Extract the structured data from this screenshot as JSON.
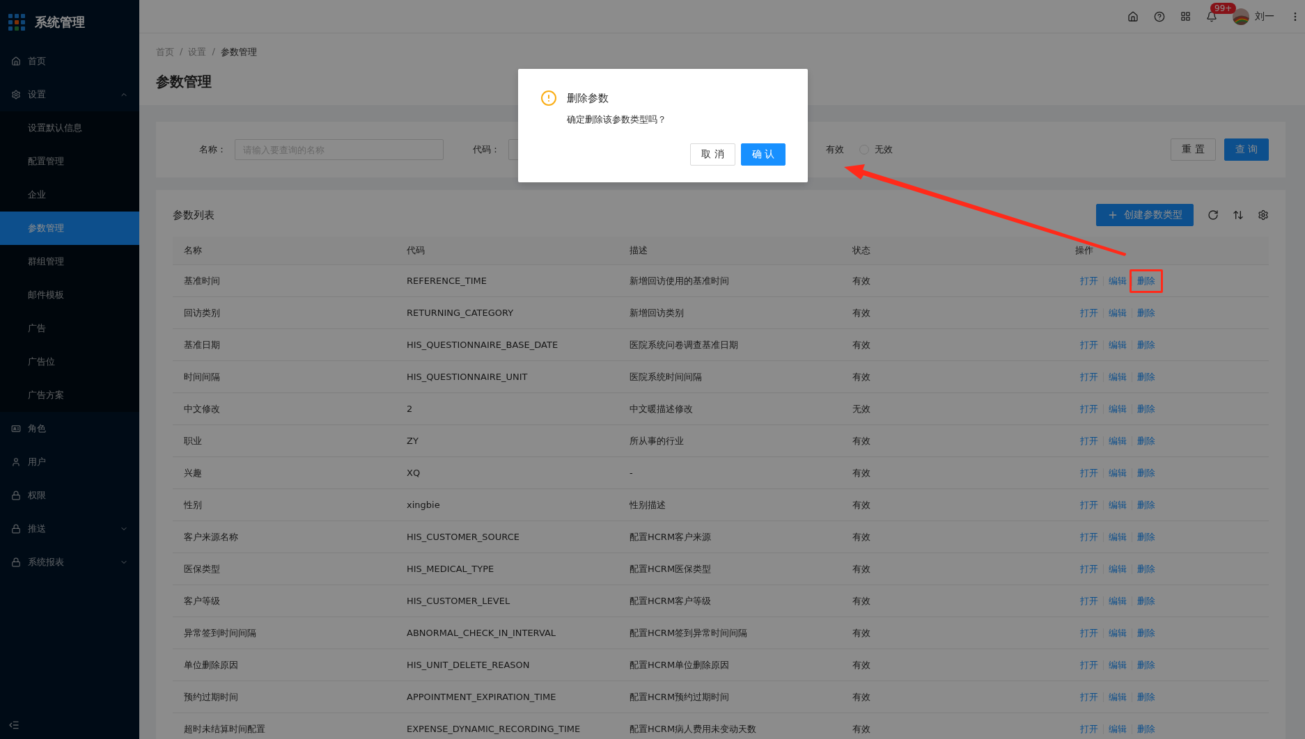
{
  "sidebar": {
    "title": "系统管理",
    "items": [
      {
        "label": "首页"
      },
      {
        "label": "设置",
        "expanded": true,
        "children": [
          {
            "label": "设置默认信息",
            "selected": false
          },
          {
            "label": "配置管理",
            "selected": false
          },
          {
            "label": "企业",
            "selected": false
          },
          {
            "label": "参数管理",
            "selected": true
          },
          {
            "label": "群组管理",
            "selected": false
          },
          {
            "label": "邮件模板",
            "selected": false
          },
          {
            "label": "广告",
            "selected": false
          },
          {
            "label": "广告位",
            "selected": false
          },
          {
            "label": "广告方案",
            "selected": false
          }
        ]
      },
      {
        "label": "角色"
      },
      {
        "label": "用户"
      },
      {
        "label": "权限"
      },
      {
        "label": "推送",
        "expanded": false
      },
      {
        "label": "系统报表",
        "expanded": false
      }
    ]
  },
  "header": {
    "notification_badge": "99+",
    "user_name": "刘一"
  },
  "breadcrumb": {
    "separator": "/",
    "items": [
      "首页",
      "设置",
      "参数管理"
    ]
  },
  "page_title": "参数管理",
  "filter": {
    "fields": [
      {
        "label": "名称：",
        "placeholder": "请输入要查询的名称"
      },
      {
        "label": "代码："
      }
    ],
    "status_options": [
      {
        "label": "有效"
      },
      {
        "label": "无效",
        "selected": false
      }
    ],
    "buttons": [
      "重 置",
      "查 询"
    ]
  },
  "table": {
    "title": "参数列表",
    "create_button": "创建参数类型",
    "columns": [
      "名称",
      "代码",
      "描述",
      "状态",
      "操作"
    ],
    "rows": [
      {
        "name": "基准时间",
        "code": "REFERENCE_TIME",
        "description": "新增回访使用的基准时间",
        "status": "有效",
        "actions": [
          "打开",
          "编辑",
          "删除"
        ],
        "marked": true
      },
      {
        "name": "回访类别",
        "code": "RETURNING_CATEGORY",
        "description": "新增回访类别",
        "status": "有效",
        "actions": [
          "打开",
          "编辑",
          "删除"
        ],
        "marked": false
      },
      {
        "name": "基准日期",
        "code": "HIS_QUESTIONNAIRE_BASE_DATE",
        "description": "医院系统问卷调查基准日期",
        "status": "有效",
        "actions": [
          "打开",
          "编辑",
          "删除"
        ],
        "marked": false
      },
      {
        "name": "时间间隔",
        "code": "HIS_QUESTIONNAIRE_UNIT",
        "description": "医院系统时间间隔",
        "status": "有效",
        "actions": [
          "打开",
          "编辑",
          "删除"
        ],
        "marked": false
      },
      {
        "name": "中文修改",
        "code": "2",
        "description": "中文暖描述修改",
        "status": "无效",
        "actions": [
          "打开",
          "编辑",
          "删除"
        ],
        "marked": false
      },
      {
        "name": "职业",
        "code": "ZY",
        "description": "所从事的行业",
        "status": "有效",
        "actions": [
          "打开",
          "编辑",
          "删除"
        ],
        "marked": false
      },
      {
        "name": "兴趣",
        "code": "XQ",
        "description": "-",
        "status": "有效",
        "actions": [
          "打开",
          "编辑",
          "删除"
        ],
        "marked": false
      },
      {
        "name": "性别",
        "code": "xingbie",
        "description": "性别描述",
        "status": "有效",
        "actions": [
          "打开",
          "编辑",
          "删除"
        ],
        "marked": false
      },
      {
        "name": "客户来源名称",
        "code": "HIS_CUSTOMER_SOURCE",
        "description": "配置HCRM客户来源",
        "status": "有效",
        "actions": [
          "打开",
          "编辑",
          "删除"
        ],
        "marked": false
      },
      {
        "name": "医保类型",
        "code": "HIS_MEDICAL_TYPE",
        "description": "配置HCRM医保类型",
        "status": "有效",
        "actions": [
          "打开",
          "编辑",
          "删除"
        ],
        "marked": false
      },
      {
        "name": "客户等级",
        "code": "HIS_CUSTOMER_LEVEL",
        "description": "配置HCRM客户等级",
        "status": "有效",
        "actions": [
          "打开",
          "编辑",
          "删除"
        ],
        "marked": false
      },
      {
        "name": "异常签到时间间隔",
        "code": "ABNORMAL_CHECK_IN_INTERVAL",
        "description": "配置HCRM签到异常时间间隔",
        "status": "有效",
        "actions": [
          "打开",
          "编辑",
          "删除"
        ],
        "marked": false
      },
      {
        "name": "单位删除原因",
        "code": "HIS_UNIT_DELETE_REASON",
        "description": "配置HCRM单位删除原因",
        "status": "有效",
        "actions": [
          "打开",
          "编辑",
          "删除"
        ],
        "marked": false
      },
      {
        "name": "预约过期时间",
        "code": "APPOINTMENT_EXPIRATION_TIME",
        "description": "配置HCRM预约过期时间",
        "status": "有效",
        "actions": [
          "打开",
          "编辑",
          "删除"
        ],
        "marked": false
      },
      {
        "name": "超时未结算时间配置",
        "code": "EXPENSE_DYNAMIC_RECORDING_TIME",
        "description": "配置HCRM病人费用未变动天数",
        "status": "有效",
        "actions": [
          "打开",
          "编辑",
          "删除"
        ],
        "marked": false
      }
    ]
  },
  "dialog": {
    "title": "删除参数",
    "message": "确定删除该参数类型吗？",
    "buttons": [
      "取 消",
      "确 认"
    ]
  }
}
